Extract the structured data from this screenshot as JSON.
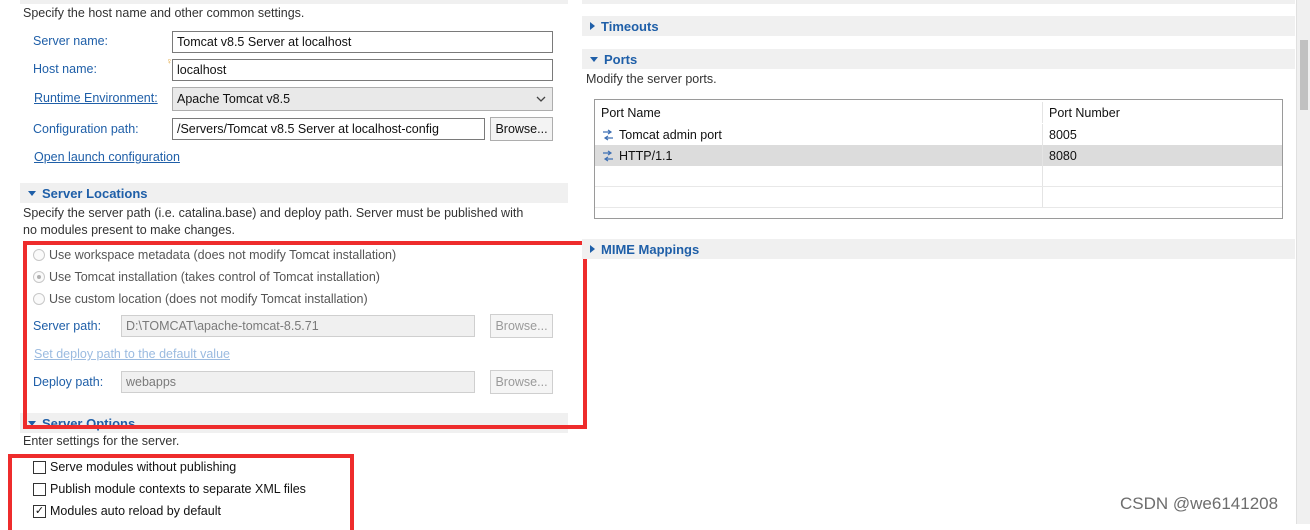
{
  "general": {
    "description": "Specify the host name and other common settings.",
    "server_name_label": "Server name:",
    "server_name_value": "Tomcat v8.5 Server at localhost",
    "host_name_label": "Host name:",
    "host_name_value": "localhost",
    "runtime_label": "Runtime Environment:",
    "runtime_value": "Apache Tomcat v8.5",
    "config_path_label": "Configuration path:",
    "config_path_value": "/Servers/Tomcat v8.5 Server at localhost-config",
    "browse_label": "Browse...",
    "open_launch_label": "Open launch configuration"
  },
  "server_locations": {
    "title": "Server Locations",
    "description_line1": "Specify the server path (i.e. catalina.base) and deploy path. Server must be published with",
    "description_line2": "no modules present to make changes.",
    "radio_workspace": "Use workspace metadata (does not modify Tomcat installation)",
    "radio_tomcat": "Use Tomcat installation (takes control of Tomcat installation)",
    "radio_custom": "Use custom location (does not modify Tomcat installation)",
    "selected_option": "Use Tomcat installation (takes control of Tomcat installation)",
    "server_path_label": "Server path:",
    "server_path_value": "D:\\TOMCAT\\apache-tomcat-8.5.71",
    "browse_label": "Browse...",
    "set_deploy_link": "Set deploy path to the default value",
    "deploy_path_label": "Deploy path:",
    "deploy_path_value": "webapps"
  },
  "server_options": {
    "title": "Server Options",
    "description": "Enter settings for the server.",
    "serve_modules_label": "Serve modules without publishing",
    "serve_modules_checked": false,
    "publish_contexts_label": "Publish module contexts to separate XML files",
    "publish_contexts_checked": false,
    "auto_reload_label": "Modules auto reload by default",
    "auto_reload_checked": true,
    "checkmark": "✓"
  },
  "right": {
    "timeouts_title": "Timeouts",
    "ports_title": "Ports",
    "ports_description": "Modify the server ports.",
    "ports_columns": [
      "Port Name",
      "Port Number"
    ],
    "ports_rows": [
      {
        "name": "Tomcat admin port",
        "number": "8005"
      },
      {
        "name": "HTTP/1.1",
        "number": "8080"
      }
    ],
    "mime_title": "MIME Mappings"
  },
  "colors": {
    "accent_blue": "#1f5fa8",
    "highlight_red": "#ee2c2c",
    "selected_row": "#dcdcdc"
  },
  "watermark": "CSDN @we6141208"
}
